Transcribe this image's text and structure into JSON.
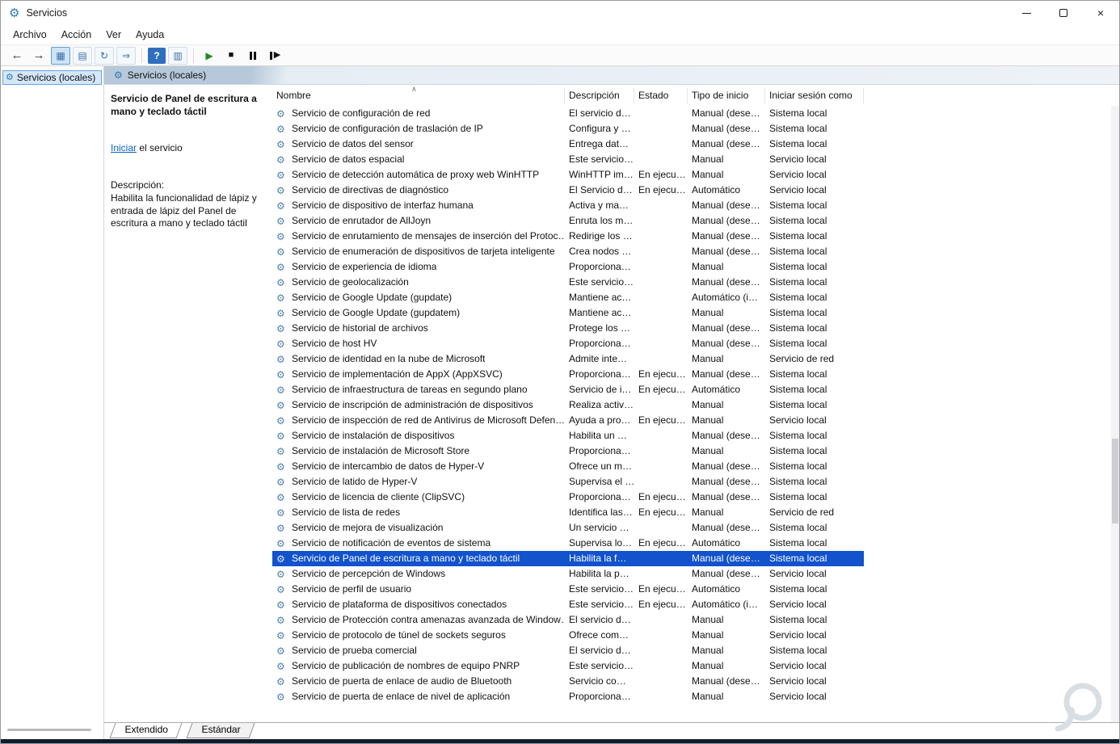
{
  "window": {
    "title": "Servicios"
  },
  "menu": {
    "items": [
      "Archivo",
      "Acción",
      "Ver",
      "Ayuda"
    ]
  },
  "tree": {
    "root_label": "Servicios (locales)"
  },
  "pane": {
    "header": "Servicios (locales)"
  },
  "detail": {
    "service_title": "Servicio de Panel de escritura a mano y teclado táctil",
    "start_link": "Iniciar",
    "start_suffix": " el servicio",
    "description_label": "Descripción:",
    "description_text": "Habilita la funcionalidad de lápiz y entrada de lápiz del Panel de escritura a mano y teclado táctil"
  },
  "tabs": {
    "extended": "Extendido",
    "standard": "Estándar"
  },
  "colors": {
    "selection_bg": "#1252cc",
    "link": "#0b62c4"
  },
  "table": {
    "columns": [
      "Nombre",
      "Descripción",
      "Estado",
      "Tipo de inicio",
      "Iniciar sesión como"
    ],
    "selected_index": 29,
    "rows": [
      {
        "name": "Servicio de configuración de red",
        "description": "El servicio d…",
        "status": "",
        "startup_type": "Manual (dese…",
        "logon_as": "Sistema local"
      },
      {
        "name": "Servicio de configuración de traslación de IP",
        "description": "Configura y …",
        "status": "",
        "startup_type": "Manual (dese…",
        "logon_as": "Sistema local"
      },
      {
        "name": "Servicio de datos del sensor",
        "description": "Entrega dat…",
        "status": "",
        "startup_type": "Manual (dese…",
        "logon_as": "Sistema local"
      },
      {
        "name": "Servicio de datos espacial",
        "description": "Este servicio…",
        "status": "",
        "startup_type": "Manual",
        "logon_as": "Servicio local"
      },
      {
        "name": "Servicio de detección automática de proxy web WinHTTP",
        "description": "WinHTTP im…",
        "status": "En ejecu…",
        "startup_type": "Manual",
        "logon_as": "Servicio local"
      },
      {
        "name": "Servicio de directivas de diagnóstico",
        "description": "El Servicio d…",
        "status": "En ejecu…",
        "startup_type": "Automático",
        "logon_as": "Servicio local"
      },
      {
        "name": "Servicio de dispositivo de interfaz humana",
        "description": "Activa y ma…",
        "status": "",
        "startup_type": "Manual (dese…",
        "logon_as": "Sistema local"
      },
      {
        "name": "Servicio de enrutador de AllJoyn",
        "description": "Enruta los m…",
        "status": "",
        "startup_type": "Manual (dese…",
        "logon_as": "Sistema local"
      },
      {
        "name": "Servicio de enrutamiento de mensajes de inserción del Protoc…",
        "description": "Redirige los …",
        "status": "",
        "startup_type": "Manual (dese…",
        "logon_as": "Sistema local"
      },
      {
        "name": "Servicio de enumeración de dispositivos de tarjeta inteligente",
        "description": "Crea nodos …",
        "status": "",
        "startup_type": "Manual (dese…",
        "logon_as": "Sistema local"
      },
      {
        "name": "Servicio de experiencia de idioma",
        "description": "Proporciona…",
        "status": "",
        "startup_type": "Manual",
        "logon_as": "Sistema local"
      },
      {
        "name": "Servicio de geolocalización",
        "description": "Este servicio…",
        "status": "",
        "startup_type": "Manual (dese…",
        "logon_as": "Sistema local"
      },
      {
        "name": "Servicio de Google Update (gupdate)",
        "description": "Mantiene ac…",
        "status": "",
        "startup_type": "Automático (i…",
        "logon_as": "Sistema local"
      },
      {
        "name": "Servicio de Google Update (gupdatem)",
        "description": "Mantiene ac…",
        "status": "",
        "startup_type": "Manual",
        "logon_as": "Sistema local"
      },
      {
        "name": "Servicio de historial de archivos",
        "description": "Protege los …",
        "status": "",
        "startup_type": "Manual (dese…",
        "logon_as": "Sistema local"
      },
      {
        "name": "Servicio de host HV",
        "description": "Proporciona…",
        "status": "",
        "startup_type": "Manual (dese…",
        "logon_as": "Sistema local"
      },
      {
        "name": "Servicio de identidad en la nube de Microsoft",
        "description": "Admite inte…",
        "status": "",
        "startup_type": "Manual",
        "logon_as": "Servicio de red"
      },
      {
        "name": "Servicio de implementación de AppX (AppXSVC)",
        "description": "Proporciona…",
        "status": "En ejecu…",
        "startup_type": "Manual (dese…",
        "logon_as": "Sistema local"
      },
      {
        "name": "Servicio de infraestructura de tareas en segundo plano",
        "description": "Servicio de i…",
        "status": "En ejecu…",
        "startup_type": "Automático",
        "logon_as": "Sistema local"
      },
      {
        "name": "Servicio de inscripción de administración de dispositivos",
        "description": "Realiza activ…",
        "status": "",
        "startup_type": "Manual",
        "logon_as": "Sistema local"
      },
      {
        "name": "Servicio de inspección de red de Antivirus de Microsoft Defen…",
        "description": "Ayuda a pro…",
        "status": "En ejecu…",
        "startup_type": "Manual",
        "logon_as": "Servicio local"
      },
      {
        "name": "Servicio de instalación de dispositivos",
        "description": "Habilita un …",
        "status": "",
        "startup_type": "Manual (dese…",
        "logon_as": "Sistema local"
      },
      {
        "name": "Servicio de instalación de Microsoft Store",
        "description": "Proporciona…",
        "status": "",
        "startup_type": "Manual",
        "logon_as": "Sistema local"
      },
      {
        "name": "Servicio de intercambio de datos de Hyper-V",
        "description": "Ofrece un m…",
        "status": "",
        "startup_type": "Manual (dese…",
        "logon_as": "Sistema local"
      },
      {
        "name": "Servicio de latido de Hyper-V",
        "description": "Supervisa el …",
        "status": "",
        "startup_type": "Manual (dese…",
        "logon_as": "Sistema local"
      },
      {
        "name": "Servicio de licencia de cliente (ClipSVC)",
        "description": "Proporciona…",
        "status": "En ejecu…",
        "startup_type": "Manual (dese…",
        "logon_as": "Sistema local"
      },
      {
        "name": "Servicio de lista de redes",
        "description": "Identifica las…",
        "status": "En ejecu…",
        "startup_type": "Manual",
        "logon_as": "Servicio de red"
      },
      {
        "name": "Servicio de mejora de visualización",
        "description": "Un servicio …",
        "status": "",
        "startup_type": "Manual (dese…",
        "logon_as": "Sistema local"
      },
      {
        "name": "Servicio de notificación de eventos de sistema",
        "description": "Supervisa lo…",
        "status": "En ejecu…",
        "startup_type": "Automático",
        "logon_as": "Sistema local"
      },
      {
        "name": "Servicio de Panel de escritura a mano y teclado táctil",
        "description": "Habilita la f…",
        "status": "",
        "startup_type": "Manual (dese…",
        "logon_as": "Sistema local"
      },
      {
        "name": "Servicio de percepción de Windows",
        "description": "Habilita la p…",
        "status": "",
        "startup_type": "Manual (dese…",
        "logon_as": "Servicio local"
      },
      {
        "name": "Servicio de perfil de usuario",
        "description": "Este servicio…",
        "status": "En ejecu…",
        "startup_type": "Automático",
        "logon_as": "Sistema local"
      },
      {
        "name": "Servicio de plataforma de dispositivos conectados",
        "description": "Este servicio…",
        "status": "En ejecu…",
        "startup_type": "Automático (i…",
        "logon_as": "Servicio local"
      },
      {
        "name": "Servicio de Protección contra amenazas avanzada de Window…",
        "description": "El servicio d…",
        "status": "",
        "startup_type": "Manual",
        "logon_as": "Sistema local"
      },
      {
        "name": "Servicio de protocolo de túnel de sockets seguros",
        "description": "Ofrece com…",
        "status": "",
        "startup_type": "Manual",
        "logon_as": "Servicio local"
      },
      {
        "name": "Servicio de prueba comercial",
        "description": "El servicio d…",
        "status": "",
        "startup_type": "Manual",
        "logon_as": "Sistema local"
      },
      {
        "name": "Servicio de publicación de nombres de equipo PNRP",
        "description": "Este servicio…",
        "status": "",
        "startup_type": "Manual",
        "logon_as": "Servicio local"
      },
      {
        "name": "Servicio de puerta de enlace de audio de Bluetooth",
        "description": "Servicio co…",
        "status": "",
        "startup_type": "Manual (dese…",
        "logon_as": "Servicio local"
      },
      {
        "name": "Servicio de puerta de enlace de nivel de aplicación",
        "description": "Proporciona…",
        "status": "",
        "startup_type": "Manual",
        "logon_as": "Servicio local"
      }
    ]
  }
}
